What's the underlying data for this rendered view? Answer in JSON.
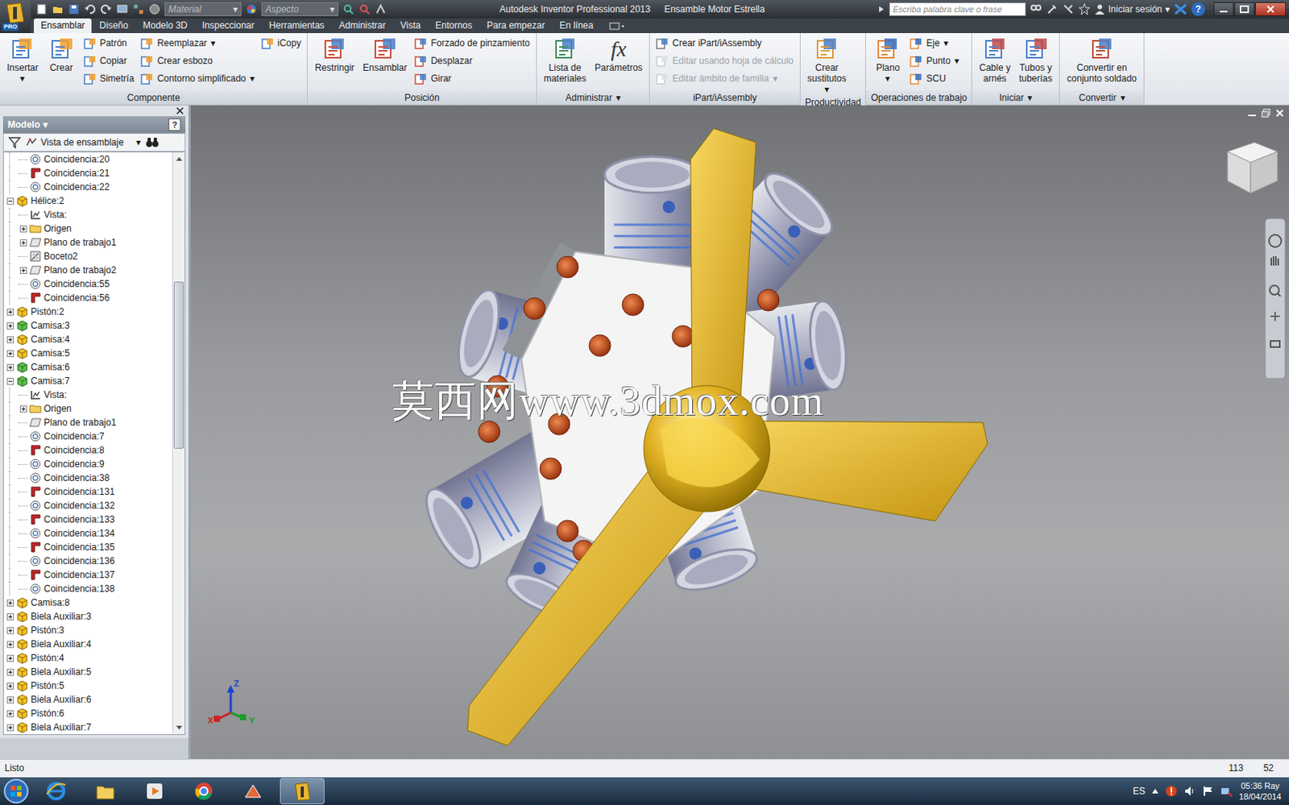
{
  "window": {
    "badge": "PRO",
    "title": "Autodesk Inventor Professional 2013",
    "document": "Ensamble Motor Estrella"
  },
  "quick_access": {
    "material": {
      "label": "Material",
      "arrow": "▾"
    },
    "appearance": {
      "label": "Aspecto",
      "arrow": "▾"
    }
  },
  "search": {
    "placeholder": "Escriba palabra clave o frase"
  },
  "sign_in": {
    "label": "Iniciar sesión",
    "arrow": "▾"
  },
  "help": "?",
  "tabs": [
    {
      "label": "Ensamblar",
      "selected": true
    },
    {
      "label": "Diseño",
      "selected": false
    },
    {
      "label": "Modelo 3D",
      "selected": false
    },
    {
      "label": "Inspeccionar",
      "selected": false
    },
    {
      "label": "Herramientas",
      "selected": false
    },
    {
      "label": "Administrar",
      "selected": false
    },
    {
      "label": "Vista",
      "selected": false
    },
    {
      "label": "Entornos",
      "selected": false
    },
    {
      "label": "Para empezar",
      "selected": false
    },
    {
      "label": "En línea",
      "selected": false
    }
  ],
  "ribbon": {
    "groups": [
      {
        "title": "Componente",
        "items": [
          {
            "kind": "large",
            "lines": [
              "Insertar"
            ],
            "arrow": "▾",
            "disabled": false
          },
          {
            "kind": "large",
            "lines": [
              "Crear"
            ],
            "disabled": false
          },
          {
            "kind": "small",
            "label": "Patrón",
            "disabled": false
          },
          {
            "kind": "small",
            "label": "Copiar",
            "disabled": false
          },
          {
            "kind": "small",
            "label": "Simetría",
            "disabled": false
          },
          {
            "kind": "small",
            "label": "Reemplazar",
            "arrow": "▾",
            "disabled": false
          },
          {
            "kind": "small",
            "label": "Crear esbozo",
            "disabled": false
          },
          {
            "kind": "small",
            "label": "Contorno simplificado",
            "arrow": "▾",
            "disabled": false
          },
          {
            "kind": "small",
            "label": "iCopy",
            "disabled": false
          }
        ]
      },
      {
        "title": "Posición",
        "items": [
          {
            "kind": "large",
            "lines": [
              "Restringir"
            ],
            "disabled": false
          },
          {
            "kind": "large",
            "lines": [
              "Ensamblar"
            ],
            "disabled": false
          },
          {
            "kind": "small",
            "label": "Forzado de pinzamiento",
            "disabled": false
          },
          {
            "kind": "small",
            "label": "Desplazar",
            "disabled": false
          },
          {
            "kind": "small",
            "label": "Girar",
            "disabled": false
          }
        ]
      },
      {
        "title": "Administrar",
        "arrow": "▾",
        "items": [
          {
            "kind": "large",
            "lines": [
              "Lista de",
              "materiales"
            ],
            "disabled": false
          },
          {
            "kind": "large",
            "lines": [
              "Parámetros"
            ],
            "icon_text": "fx",
            "disabled": false
          }
        ]
      },
      {
        "title": "iPart/iAssembly",
        "items": [
          {
            "kind": "small",
            "label": "Crear iPart/iAssembly",
            "disabled": false
          },
          {
            "kind": "small",
            "label": "Editar usando hoja de cálculo",
            "disabled": true
          },
          {
            "kind": "small",
            "label": "Editar ámbito de familia",
            "arrow": "▾",
            "disabled": true
          }
        ]
      },
      {
        "title": "Productividad",
        "items": [
          {
            "kind": "large",
            "lines": [
              "Crear",
              "sustitutos"
            ],
            "arrow": "▾",
            "disabled": false
          }
        ]
      },
      {
        "title": "Operaciones de trabajo",
        "items": [
          {
            "kind": "large",
            "lines": [
              "Plano"
            ],
            "arrow": "▾",
            "disabled": false
          },
          {
            "kind": "small",
            "label": "Eje",
            "arrow": "▾",
            "disabled": false
          },
          {
            "kind": "small",
            "label": "Punto",
            "arrow": "▾",
            "disabled": false
          },
          {
            "kind": "small",
            "label": "SCU",
            "disabled": false
          }
        ]
      },
      {
        "title": "Iniciar",
        "arrow": "▾",
        "items": [
          {
            "kind": "large",
            "lines": [
              "Cable y",
              "arnés"
            ],
            "disabled": false
          },
          {
            "kind": "large",
            "lines": [
              "Tubos y",
              "tuberías"
            ],
            "disabled": false
          }
        ]
      },
      {
        "title": "Convertir",
        "arrow": "▾",
        "items": [
          {
            "kind": "large",
            "lines": [
              "Convertir en",
              "conjunto soldado"
            ],
            "disabled": false
          }
        ]
      }
    ]
  },
  "browser": {
    "title": "Modelo",
    "title_arrow": "▾",
    "help": "?",
    "view": {
      "label": "Vista de ensamblaje",
      "arrow": "▾"
    },
    "tree": [
      {
        "label": "Coincidencia:20",
        "level": 1,
        "kind": "mate",
        "toggle": "none"
      },
      {
        "label": "Coincidencia:21",
        "level": 1,
        "kind": "flush",
        "toggle": "none"
      },
      {
        "label": "Coincidencia:22",
        "level": 1,
        "kind": "mate",
        "toggle": "none"
      },
      {
        "label": "Hélice:2",
        "level": 0,
        "kind": "part",
        "toggle": "expanded"
      },
      {
        "label": "Vista:",
        "level": 1,
        "kind": "view",
        "toggle": "none"
      },
      {
        "label": "Origen",
        "level": 1,
        "kind": "folder",
        "toggle": "collapsed"
      },
      {
        "label": "Plano de trabajo1",
        "level": 1,
        "kind": "plane",
        "toggle": "collapsed"
      },
      {
        "label": "Boceto2",
        "level": 1,
        "kind": "sketch",
        "toggle": "none"
      },
      {
        "label": "Plano de trabajo2",
        "level": 1,
        "kind": "plane",
        "toggle": "collapsed"
      },
      {
        "label": "Coincidencia:55",
        "level": 1,
        "kind": "mate",
        "toggle": "none"
      },
      {
        "label": "Coincidencia:56",
        "level": 1,
        "kind": "flush",
        "toggle": "none"
      },
      {
        "label": "Pistón:2",
        "level": 0,
        "kind": "part",
        "toggle": "collapsed"
      },
      {
        "label": "Camisa:3",
        "level": 0,
        "kind": "part-green",
        "toggle": "collapsed"
      },
      {
        "label": "Camisa:4",
        "level": 0,
        "kind": "part",
        "toggle": "collapsed"
      },
      {
        "label": "Camisa:5",
        "level": 0,
        "kind": "part",
        "toggle": "collapsed"
      },
      {
        "label": "Camisa:6",
        "level": 0,
        "kind": "part-green",
        "toggle": "collapsed"
      },
      {
        "label": "Camisa:7",
        "level": 0,
        "kind": "part-green",
        "toggle": "expanded"
      },
      {
        "label": "Vista:",
        "level": 1,
        "kind": "view",
        "toggle": "none"
      },
      {
        "label": "Origen",
        "level": 1,
        "kind": "folder",
        "toggle": "collapsed"
      },
      {
        "label": "Plano de trabajo1",
        "level": 1,
        "kind": "plane",
        "toggle": "none"
      },
      {
        "label": "Coincidencia:7",
        "level": 1,
        "kind": "mate",
        "toggle": "none"
      },
      {
        "label": "Coincidencia:8",
        "level": 1,
        "kind": "flush",
        "toggle": "none"
      },
      {
        "label": "Coincidencia:9",
        "level": 1,
        "kind": "mate",
        "toggle": "none"
      },
      {
        "label": "Coincidencia:38",
        "level": 1,
        "kind": "mate",
        "toggle": "none"
      },
      {
        "label": "Coincidencia:131",
        "level": 1,
        "kind": "flush",
        "toggle": "none"
      },
      {
        "label": "Coincidencia:132",
        "level": 1,
        "kind": "mate",
        "toggle": "none"
      },
      {
        "label": "Coincidencia:133",
        "level": 1,
        "kind": "flush",
        "toggle": "none"
      },
      {
        "label": "Coincidencia:134",
        "level": 1,
        "kind": "mate",
        "toggle": "none"
      },
      {
        "label": "Coincidencia:135",
        "level": 1,
        "kind": "flush",
        "toggle": "none"
      },
      {
        "label": "Coincidencia:136",
        "level": 1,
        "kind": "mate",
        "toggle": "none"
      },
      {
        "label": "Coincidencia:137",
        "level": 1,
        "kind": "flush",
        "toggle": "none"
      },
      {
        "label": "Coincidencia:138",
        "level": 1,
        "kind": "mate",
        "toggle": "none"
      },
      {
        "label": "Camisa:8",
        "level": 0,
        "kind": "part",
        "toggle": "collapsed"
      },
      {
        "label": "Biela Auxiliar:3",
        "level": 0,
        "kind": "part",
        "toggle": "collapsed"
      },
      {
        "label": "Pistón:3",
        "level": 0,
        "kind": "part",
        "toggle": "collapsed"
      },
      {
        "label": "Biela Auxiliar:4",
        "level": 0,
        "kind": "part",
        "toggle": "collapsed"
      },
      {
        "label": "Pistón:4",
        "level": 0,
        "kind": "part",
        "toggle": "collapsed"
      },
      {
        "label": "Biela Auxiliar:5",
        "level": 0,
        "kind": "part",
        "toggle": "collapsed"
      },
      {
        "label": "Pistón:5",
        "level": 0,
        "kind": "part",
        "toggle": "collapsed"
      },
      {
        "label": "Biela Auxiliar:6",
        "level": 0,
        "kind": "part",
        "toggle": "collapsed"
      },
      {
        "label": "Pistón:6",
        "level": 0,
        "kind": "part",
        "toggle": "collapsed"
      },
      {
        "label": "Biela Auxiliar:7",
        "level": 0,
        "kind": "part",
        "toggle": "collapsed"
      }
    ],
    "scrollbar": {
      "offset": 0.21,
      "level": 0.3
    }
  },
  "viewport": {
    "watermark": "莫西网www.3dmox.com",
    "axes": [
      {
        "label": "Z",
        "color": "#1f3fd0"
      },
      {
        "label": "X",
        "color": "#d02020"
      },
      {
        "label": "Y",
        "color": "#1e9a2a"
      }
    ]
  },
  "status_bar": {
    "text": "Listo",
    "numbers": [
      "113",
      "52"
    ]
  },
  "taskbar": {
    "apps": [
      {
        "kind": "ie",
        "selected": false
      },
      {
        "kind": "explorer",
        "selected": false
      },
      {
        "kind": "media",
        "selected": false
      },
      {
        "kind": "chrome",
        "selected": false
      },
      {
        "kind": "tool",
        "selected": false
      },
      {
        "kind": "inventor",
        "selected": true
      }
    ],
    "language": "ES",
    "time": "05:36 Ray",
    "date": "18/04/2014"
  }
}
